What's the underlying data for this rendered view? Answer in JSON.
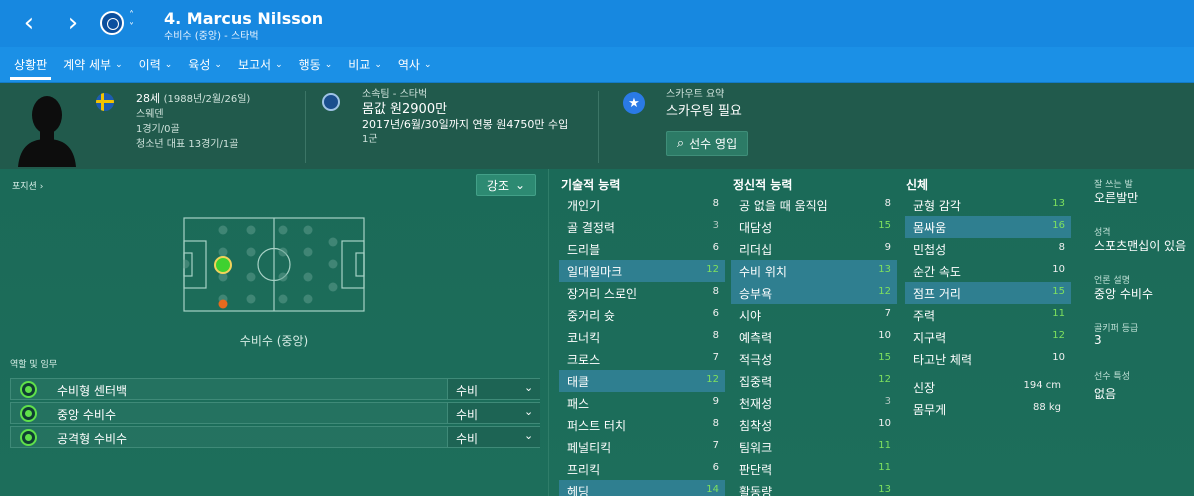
{
  "header": {
    "back_icon": "‹",
    "forward_icon": "›",
    "title": "4. Marcus Nilsson",
    "subtitle": "수비수 (중앙) - 스타벅"
  },
  "tabs": [
    {
      "label": "상황판",
      "caret": ""
    },
    {
      "label": "계약 세부",
      "caret": "⌄"
    },
    {
      "label": "이력",
      "caret": "⌄"
    },
    {
      "label": "육성",
      "caret": "⌄"
    },
    {
      "label": "보고서",
      "caret": "⌄"
    },
    {
      "label": "행동",
      "caret": "⌄"
    },
    {
      "label": "비교",
      "caret": "⌄"
    },
    {
      "label": "역사",
      "caret": "⌄"
    }
  ],
  "bio": {
    "age": "28세",
    "dob": "(1988년/2월/26일)",
    "nationality": "스웨덴",
    "caps": "1경기/0골",
    "youth": "청소년 대표 13경기/1골"
  },
  "club": {
    "label": "소속팀 - 스타벅",
    "value": "몸값 원2900만",
    "contract": "2017년/6월/30일까지 연봉 원4750만 수입",
    "squad": "1군"
  },
  "scout": {
    "label": "스카우트 요약",
    "value": "스카우팅 필요",
    "button": "선수 영입",
    "search_icon": "⌕"
  },
  "position": {
    "link": "포지션 ›",
    "emphasis_button": "강조",
    "chevron": "⌄",
    "label": "수비수 (중앙)"
  },
  "roles": {
    "title": "역할 및 임무",
    "items": [
      {
        "name": "수비형 센터백",
        "duty": "수비"
      },
      {
        "name": "중앙 수비수",
        "duty": "수비"
      },
      {
        "name": "공격형 수비수",
        "duty": "수비"
      }
    ]
  },
  "technical": {
    "title": "기술적 능력",
    "rows": [
      {
        "name": "개인기",
        "value": "8"
      },
      {
        "name": "골 결정력",
        "value": "3"
      },
      {
        "name": "드리블",
        "value": "6"
      },
      {
        "name": "일대일마크",
        "value": "12"
      },
      {
        "name": "장거리 스로인",
        "value": "8"
      },
      {
        "name": "중거리 슛",
        "value": "6"
      },
      {
        "name": "코너킥",
        "value": "8"
      },
      {
        "name": "크로스",
        "value": "7"
      },
      {
        "name": "태클",
        "value": "12"
      },
      {
        "name": "패스",
        "value": "9"
      },
      {
        "name": "퍼스트 터치",
        "value": "8"
      },
      {
        "name": "페널티킥",
        "value": "7"
      },
      {
        "name": "프리킥",
        "value": "6"
      },
      {
        "name": "헤딩",
        "value": "14"
      }
    ]
  },
  "mental": {
    "title": "정신적 능력",
    "rows": [
      {
        "name": "공 없을 때 움직임",
        "value": "8"
      },
      {
        "name": "대담성",
        "value": "15"
      },
      {
        "name": "리더십",
        "value": "9"
      },
      {
        "name": "수비 위치",
        "value": "13"
      },
      {
        "name": "승부욕",
        "value": "12"
      },
      {
        "name": "시야",
        "value": "7"
      },
      {
        "name": "예측력",
        "value": "10"
      },
      {
        "name": "적극성",
        "value": "15"
      },
      {
        "name": "집중력",
        "value": "12"
      },
      {
        "name": "천재성",
        "value": "3"
      },
      {
        "name": "침착성",
        "value": "10"
      },
      {
        "name": "팀워크",
        "value": "11"
      },
      {
        "name": "판단력",
        "value": "11"
      },
      {
        "name": "활동량",
        "value": "13"
      }
    ]
  },
  "physical": {
    "title": "신체",
    "rows": [
      {
        "name": "균형 감각",
        "value": "13"
      },
      {
        "name": "몸싸움",
        "value": "16"
      },
      {
        "name": "민첩성",
        "value": "8"
      },
      {
        "name": "순간 속도",
        "value": "10"
      },
      {
        "name": "점프 거리",
        "value": "15"
      },
      {
        "name": "주력",
        "value": "11"
      },
      {
        "name": "지구력",
        "value": "12"
      },
      {
        "name": "타고난 체력",
        "value": "10"
      }
    ],
    "height_label": "신장",
    "height": "194 cm",
    "weight_label": "몸무게",
    "weight": "88 kg"
  },
  "side": {
    "foot_label": "잘 쓰는 발",
    "foot": "오른발만",
    "personality_label": "성격",
    "personality": "스포츠맨십이 있음",
    "media_label": "언론 설명",
    "media": "중앙 수비수",
    "gk_label": "골키퍼 등급",
    "gk": "3",
    "traits_label": "선수 특성",
    "traits": "없음"
  },
  "colors": {
    "header_blue": "#1788e0",
    "tab_blue": "#1b90e6",
    "bg_green": "#1d6e5b",
    "highlight_row": "#2f7f90",
    "value_green": "#7ee05e"
  }
}
